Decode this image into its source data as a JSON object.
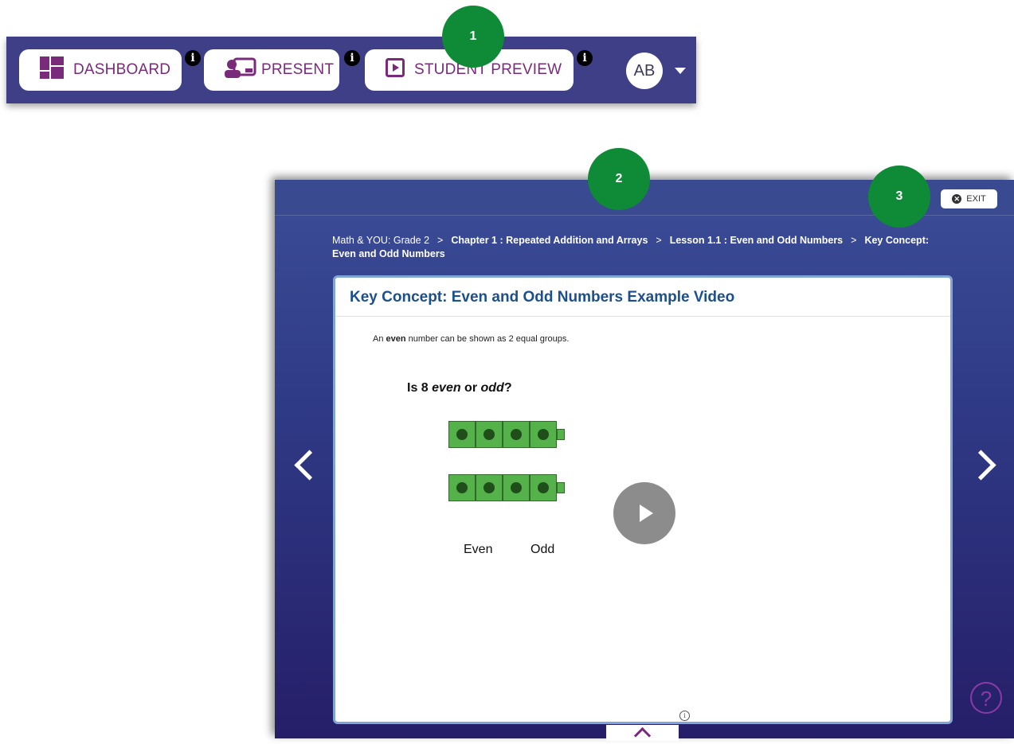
{
  "nav": {
    "dashboard_label": "DASHBOARD",
    "present_label": "PRESENT",
    "student_preview_label": "STUDENT PREVIEW",
    "info_glyph": "i",
    "avatar_initials": "AB",
    "brand_color": "#7a2a7a",
    "bar_color": "#3e3f86"
  },
  "markers": {
    "one": "1",
    "two": "2",
    "three": "3"
  },
  "preview": {
    "exit_label": "EXIT",
    "breadcrumb": {
      "item1": "Math & YOU: Grade 2",
      "sep": ">",
      "item2": "Chapter 1 : Repeated Addition and Arrays",
      "item3": "Lesson 1.1 : Even and Odd Numbers",
      "item4": "Key Concept: Even and Odd Numbers"
    },
    "card": {
      "title": "Key Concept: Even and Odd Numbers Example Video",
      "desc_pre": "An ",
      "desc_bold": "even",
      "desc_post": " number can be shown as 2 equal groups.",
      "question_pre": "Is 8 ",
      "question_even": "even",
      "question_mid": " or ",
      "question_odd": "odd",
      "question_end": "?",
      "label_even": "Even",
      "label_odd": "Odd"
    },
    "help_glyph": "?",
    "small_info_glyph": "i"
  }
}
